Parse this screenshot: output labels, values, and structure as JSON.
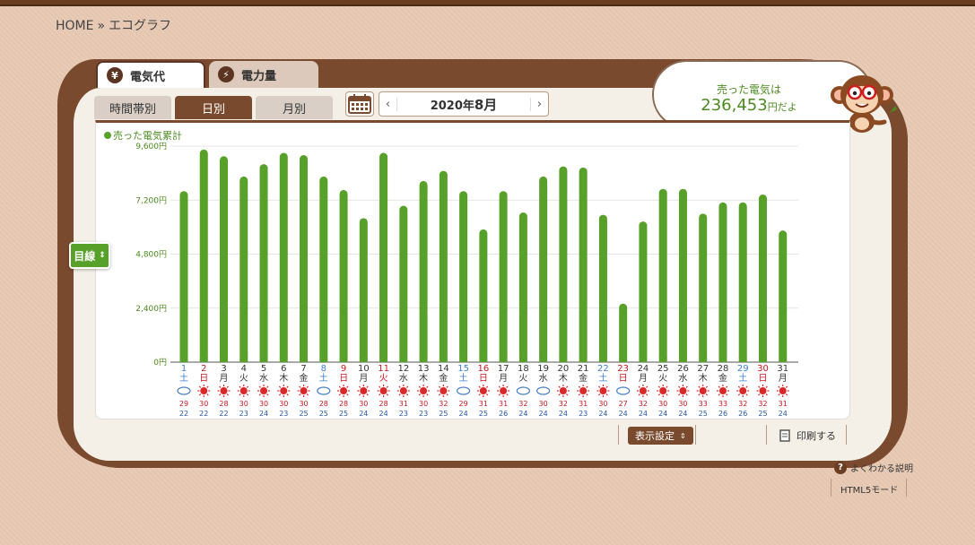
{
  "breadcrumb": {
    "home": "HOME",
    "sep": "»",
    "current": "エコグラフ"
  },
  "tabs": {
    "main": [
      {
        "label": "電気代",
        "icon": "¥"
      },
      {
        "label": "電力量",
        "icon": "⚡"
      }
    ],
    "sub": [
      "時間帯別",
      "日別",
      "月別"
    ]
  },
  "month_nav": {
    "prev": "‹",
    "next": "›",
    "label": "2020年",
    "month": "8月"
  },
  "bubble": {
    "line1": "売った電気は",
    "amount": "236,453",
    "suffix": "円だよ"
  },
  "target_button": {
    "label": "目線",
    "arrow": "⇕"
  },
  "colors": {
    "bar": "#57a02a",
    "saturday": "#3b7fd0",
    "sunday": "#c7171f",
    "frame": "#7a4a2e"
  },
  "bottom": {
    "display_settings": "表示設定",
    "print": "印刷する",
    "help": "よくわかる説明",
    "html5": "HTML5モード"
  },
  "chart_data": {
    "type": "bar",
    "legend": "売った電気累計",
    "y_ticks": [
      "0円",
      "2,400円",
      "4,800円",
      "7,200円",
      "9,600円"
    ],
    "ylim": [
      0,
      9600
    ],
    "days": [
      "1",
      "2",
      "3",
      "4",
      "5",
      "6",
      "7",
      "8",
      "9",
      "10",
      "11",
      "12",
      "13",
      "14",
      "15",
      "16",
      "17",
      "18",
      "19",
      "20",
      "21",
      "22",
      "23",
      "24",
      "25",
      "26",
      "27",
      "28",
      "29",
      "30",
      "31"
    ],
    "weekdays": [
      "土",
      "日",
      "月",
      "火",
      "水",
      "木",
      "金",
      "土",
      "日",
      "月",
      "火",
      "水",
      "木",
      "金",
      "土",
      "日",
      "月",
      "火",
      "水",
      "木",
      "金",
      "土",
      "日",
      "月",
      "火",
      "水",
      "木",
      "金",
      "土",
      "日",
      "月"
    ],
    "holidays": [
      11
    ],
    "values": [
      7600,
      9450,
      9150,
      8250,
      8800,
      9300,
      9200,
      8250,
      7650,
      6400,
      9300,
      6950,
      8050,
      8500,
      7600,
      5900,
      7600,
      6650,
      8250,
      8700,
      8650,
      6550,
      2600,
      6250,
      7700,
      7700,
      6600,
      7100,
      7100,
      7450,
      5850
    ],
    "weather": [
      "cloud",
      "sun",
      "sun",
      "sun",
      "sun",
      "sun",
      "sun",
      "cloud",
      "sun",
      "sun",
      "sun",
      "sun",
      "sun",
      "sun",
      "cloud",
      "sun",
      "sun",
      "cloud",
      "cloud",
      "sun",
      "sun",
      "sun",
      "cloud",
      "sun",
      "sun",
      "sun",
      "sun",
      "sun",
      "sun",
      "sun",
      "sun"
    ],
    "high_temp": [
      29,
      30,
      28,
      30,
      30,
      30,
      30,
      28,
      28,
      30,
      28,
      31,
      30,
      32,
      29,
      31,
      31,
      32,
      30,
      32,
      31,
      30,
      27,
      32,
      30,
      30,
      33,
      33,
      32,
      32,
      31
    ],
    "low_temp": [
      22,
      22,
      22,
      23,
      24,
      23,
      25,
      25,
      25,
      24,
      24,
      23,
      23,
      25,
      24,
      25,
      26,
      24,
      24,
      24,
      23,
      24,
      24,
      24,
      24,
      24,
      25,
      26,
      26,
      25,
      24
    ]
  }
}
